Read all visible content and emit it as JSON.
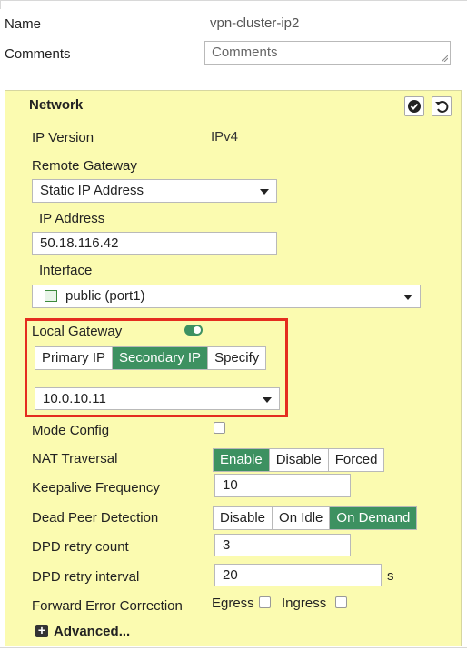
{
  "name": {
    "label": "Name",
    "value": "vpn-cluster-ip2"
  },
  "comments": {
    "label": "Comments",
    "placeholder": "Comments"
  },
  "network": {
    "title": "Network",
    "ip_version": {
      "label": "IP Version",
      "value": "IPv4"
    },
    "remote_gateway": {
      "label": "Remote Gateway",
      "selected": "Static IP Address"
    },
    "ip_address": {
      "label": "IP Address",
      "value": "50.18.116.42"
    },
    "interface": {
      "label": "Interface",
      "selected": "public (port1)"
    },
    "local_gateway": {
      "label": "Local Gateway",
      "enabled": true,
      "options": [
        "Primary IP",
        "Secondary IP",
        "Specify"
      ],
      "active": "Secondary IP",
      "selected_ip": "10.0.10.11"
    },
    "mode_config": {
      "label": "Mode Config",
      "checked": false
    },
    "nat_traversal": {
      "label": "NAT Traversal",
      "options": [
        "Enable",
        "Disable",
        "Forced"
      ],
      "active": "Enable"
    },
    "keepalive": {
      "label": "Keepalive Frequency",
      "value": "10"
    },
    "dpd": {
      "label": "Dead Peer Detection",
      "options": [
        "Disable",
        "On Idle",
        "On Demand"
      ],
      "active": "On Demand"
    },
    "dpd_retry_count": {
      "label": "DPD retry count",
      "value": "3"
    },
    "dpd_retry_interval": {
      "label": "DPD retry interval",
      "value": "20",
      "unit": "s"
    },
    "fec": {
      "label": "Forward Error Correction",
      "egress": "Egress",
      "ingress": "Ingress"
    },
    "advanced": {
      "label": "Advanced..."
    }
  },
  "colors": {
    "accent": "#3d9161",
    "panel_bg": "#fbfbb0",
    "highlight": "#e42d1f"
  },
  "icons": [
    "check-circle-icon",
    "undo-icon",
    "network-port-icon",
    "plus-square-icon",
    "chevron-down-icon",
    "toggle-on-icon"
  ]
}
